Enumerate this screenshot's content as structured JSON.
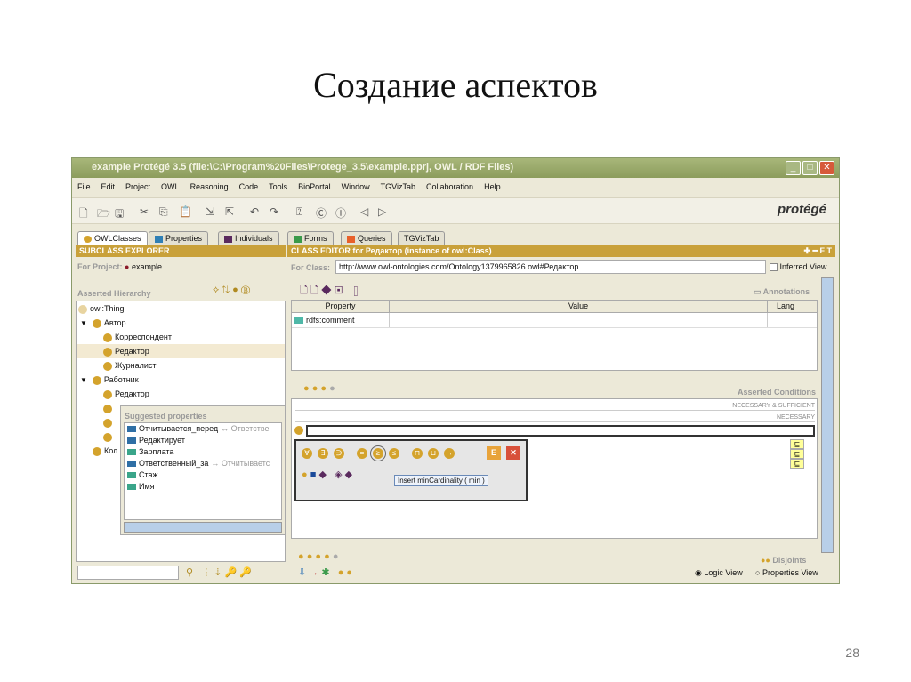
{
  "slide": {
    "title": "Создание аспектов",
    "page_number": "28"
  },
  "window": {
    "title": "example  Protégé 3.5     (file:\\C:\\Program%20Files\\Protege_3.5\\example.pprj, OWL / RDF Files)"
  },
  "menu": [
    "File",
    "Edit",
    "Project",
    "OWL",
    "Reasoning",
    "Code",
    "Tools",
    "BioPortal",
    "Window",
    "TGVizTab",
    "Collaboration",
    "Help"
  ],
  "logo": "protégé",
  "tabs": [
    {
      "label": "OWLClasses",
      "color": "#d4a32c"
    },
    {
      "label": "Properties",
      "color": "#2f7fb5"
    },
    {
      "label": "Individuals",
      "color": "#5a2a5e"
    },
    {
      "label": "Forms",
      "color": "#3a9a4a"
    },
    {
      "label": "Queries",
      "color": "#e8602a"
    },
    {
      "label": "TGVizTab",
      "color": ""
    }
  ],
  "subclass_explorer": {
    "header": "SUBCLASS EXPLORER",
    "for_project_label": "For Project:",
    "project": "example",
    "hierarchy_label": "Asserted Hierarchy",
    "tree": [
      {
        "label": "owl:Thing",
        "level": 0
      },
      {
        "label": "Автор",
        "level": 1,
        "expanded": true
      },
      {
        "label": "Корреспондент",
        "level": 2
      },
      {
        "label": "Редактор",
        "level": 2,
        "selected": true
      },
      {
        "label": "Журналист",
        "level": 2
      },
      {
        "label": "Работник",
        "level": 1,
        "expanded": true
      },
      {
        "label": "Редактор",
        "level": 2
      },
      {
        "label": "Кол",
        "level": 1
      }
    ]
  },
  "suggested": {
    "title": "Suggested properties",
    "items": [
      {
        "label": "Отчитывается_перед",
        "inverse": "↔ Ответстве",
        "type": "object"
      },
      {
        "label": "Редактирует",
        "inverse": "",
        "type": "object"
      },
      {
        "label": "Зарплата",
        "inverse": "",
        "type": "datatype"
      },
      {
        "label": "Ответственный_за",
        "inverse": "↔ Отчитываетс",
        "type": "object"
      },
      {
        "label": "Стаж",
        "inverse": "",
        "type": "datatype"
      },
      {
        "label": "Имя",
        "inverse": "",
        "type": "datatype"
      }
    ]
  },
  "class_editor": {
    "header": "CLASS EDITOR for Редактор   (instance of owl:Class)",
    "for_class_label": "For Class:",
    "for_class_value": "http://www.owl-ontologies.com/Ontology1379965826.owl#Редактор",
    "inferred_view": "Inferred View",
    "annotations": "Annotations",
    "columns": [
      "Property",
      "Value",
      "Lang"
    ],
    "rows": [
      {
        "property": "rdfs:comment",
        "value": "",
        "lang": ""
      }
    ],
    "asserted_conditions": "Asserted Conditions",
    "necessary_sufficient": "NECESSARY & SUFFICIENT",
    "necessary": "NECESSARY",
    "tooltip": "Insert minCardinality ( min )",
    "disjoints": "Disjoints",
    "logic_view": "Logic View",
    "properties_view": "Properties View",
    "selected_view": "Logic View",
    "row1_symbols": [
      "∀",
      "∃",
      "∋",
      "=",
      "≥",
      "≤",
      "⊓",
      "⊔",
      "¬"
    ],
    "subclass_symbol": "⊑"
  }
}
